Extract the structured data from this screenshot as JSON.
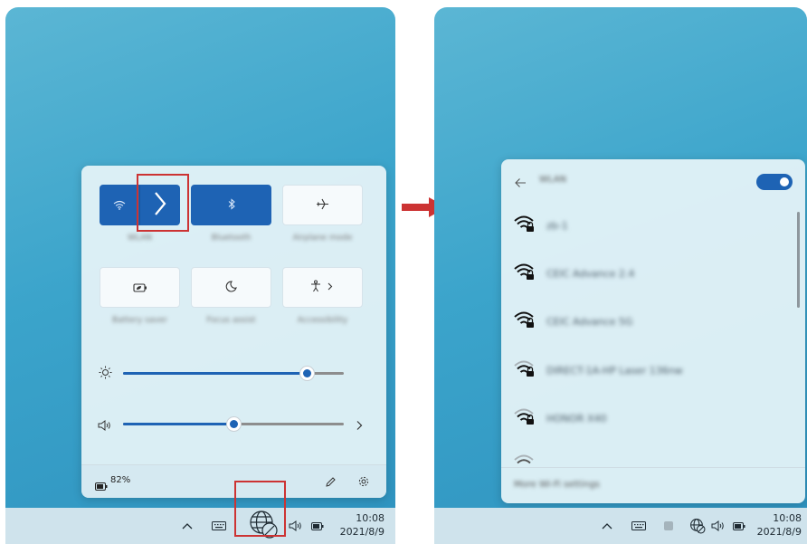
{
  "quick_settings": {
    "tiles": [
      {
        "label": "WLAN",
        "icon": "wifi-icon",
        "active": true
      },
      {
        "label": "Bluetooth",
        "icon": "bluetooth-icon",
        "active": true
      },
      {
        "label": "Airplane mode",
        "icon": "airplane-icon",
        "active": false
      },
      {
        "label": "Battery saver",
        "icon": "battery-saver-icon",
        "active": false
      },
      {
        "label": "Focus assist",
        "icon": "moon-icon",
        "active": false
      },
      {
        "label": "Accessibility",
        "icon": "accessibility-icon",
        "active": false
      }
    ],
    "brightness_level": 0.83,
    "volume_level": 0.5,
    "battery_text": "82%"
  },
  "wifi_panel": {
    "title": "WLAN",
    "enabled": true,
    "networks": [
      {
        "name": "zb-1",
        "strength": "strong",
        "secured": true
      },
      {
        "name": "CEIC Advance 2.4",
        "strength": "strong",
        "secured": true
      },
      {
        "name": "CEIC Advance 5G",
        "strength": "strong",
        "secured": true
      },
      {
        "name": "DIRECT-1A-HP Laser 136nw",
        "strength": "medium",
        "secured": true
      },
      {
        "name": "HONOR X40",
        "strength": "medium",
        "secured": true
      }
    ],
    "footer_text": "More Wi-Fi settings"
  },
  "taskbar": {
    "time": "10:08",
    "date": "2021/8/9"
  },
  "colors": {
    "accent": "#1e63b4",
    "highlight": "#cc3333"
  }
}
